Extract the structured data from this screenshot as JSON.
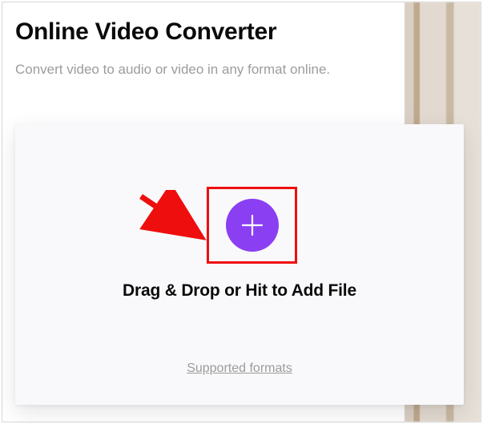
{
  "header": {
    "title": "Online Video Converter",
    "subtitle": "Convert video to audio or video in any format online."
  },
  "dropzone": {
    "instruction": "Drag & Drop or Hit to Add File",
    "supported_link": "Supported formats"
  },
  "colors": {
    "accent": "#8b3ff2",
    "highlight_box": "#ee0e0e",
    "arrow": "#ee0e0e"
  }
}
